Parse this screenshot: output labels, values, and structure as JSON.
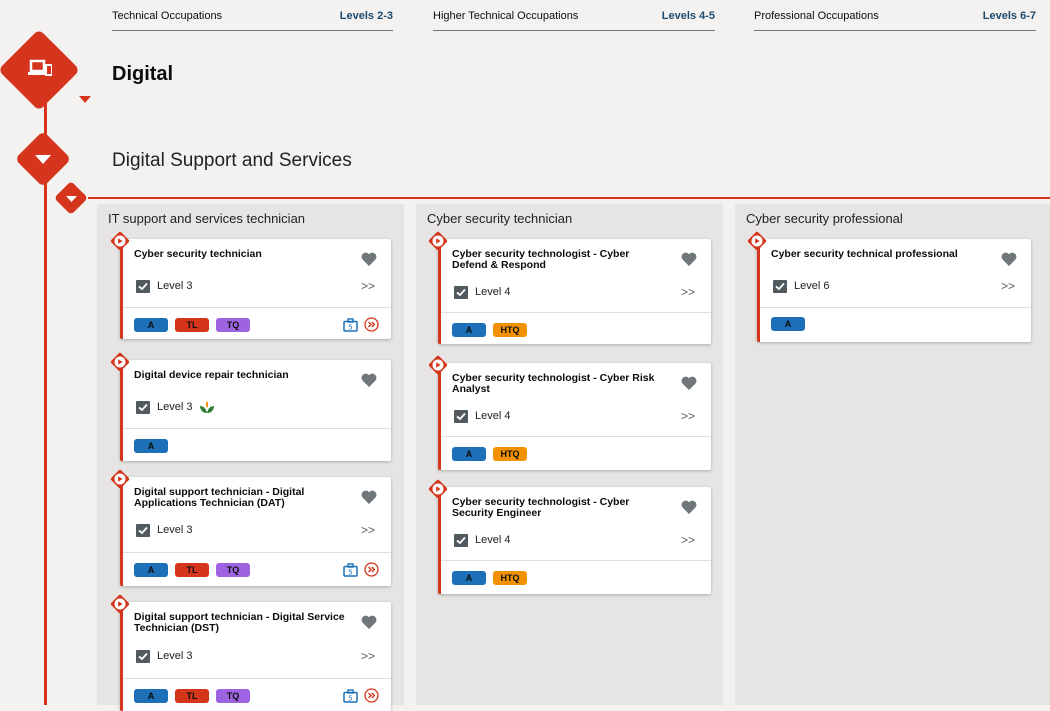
{
  "levels": [
    {
      "name": "Technical Occupations",
      "range": "Levels 2-3"
    },
    {
      "name": "Higher Technical Occupations",
      "range": "Levels 4-5"
    },
    {
      "name": "Professional Occupations",
      "range": "Levels 6-7"
    }
  ],
  "route": {
    "title": "Digital"
  },
  "pathway": {
    "title": "Digital Support and Services"
  },
  "colors": {
    "accent": "#d4351c",
    "tag_a": "#1d70b8",
    "tag_tl": "#d4351c",
    "tag_tq": "#9e63e0",
    "tag_htq": "#f39200"
  },
  "columns": [
    {
      "title": "IT support and services technician",
      "cards": [
        {
          "title": "Cyber security technician",
          "level": "Level 3",
          "tags": [
            "A",
            "TL",
            "TQ"
          ]
        },
        {
          "title": "Digital device repair technician",
          "level": "Level 3",
          "tags": [
            "A"
          ]
        },
        {
          "title": "Digital support technician - Digital Applications Technician (DAT)",
          "level": "Level 3",
          "tags": [
            "A",
            "TL",
            "TQ"
          ]
        },
        {
          "title": "Digital support technician - Digital Service Technician (DST)",
          "level": "Level 3",
          "tags": [
            "A",
            "TL",
            "TQ"
          ]
        }
      ]
    },
    {
      "title": "Cyber security technician",
      "cards": [
        {
          "title": "Cyber security technologist - Cyber Defend & Respond",
          "level": "Level 4",
          "tags": [
            "A",
            "HTQ"
          ]
        },
        {
          "title": "Cyber security technologist - Cyber Risk Analyst",
          "level": "Level 4",
          "tags": [
            "A",
            "HTQ"
          ]
        },
        {
          "title": "Cyber security technologist - Cyber Security Engineer",
          "level": "Level 4",
          "tags": [
            "A",
            "HTQ"
          ]
        }
      ]
    },
    {
      "title": "Cyber security professional",
      "cards": [
        {
          "title": "Cyber security technical professional",
          "level": "Level 6",
          "tags": [
            "A"
          ]
        }
      ]
    }
  ]
}
